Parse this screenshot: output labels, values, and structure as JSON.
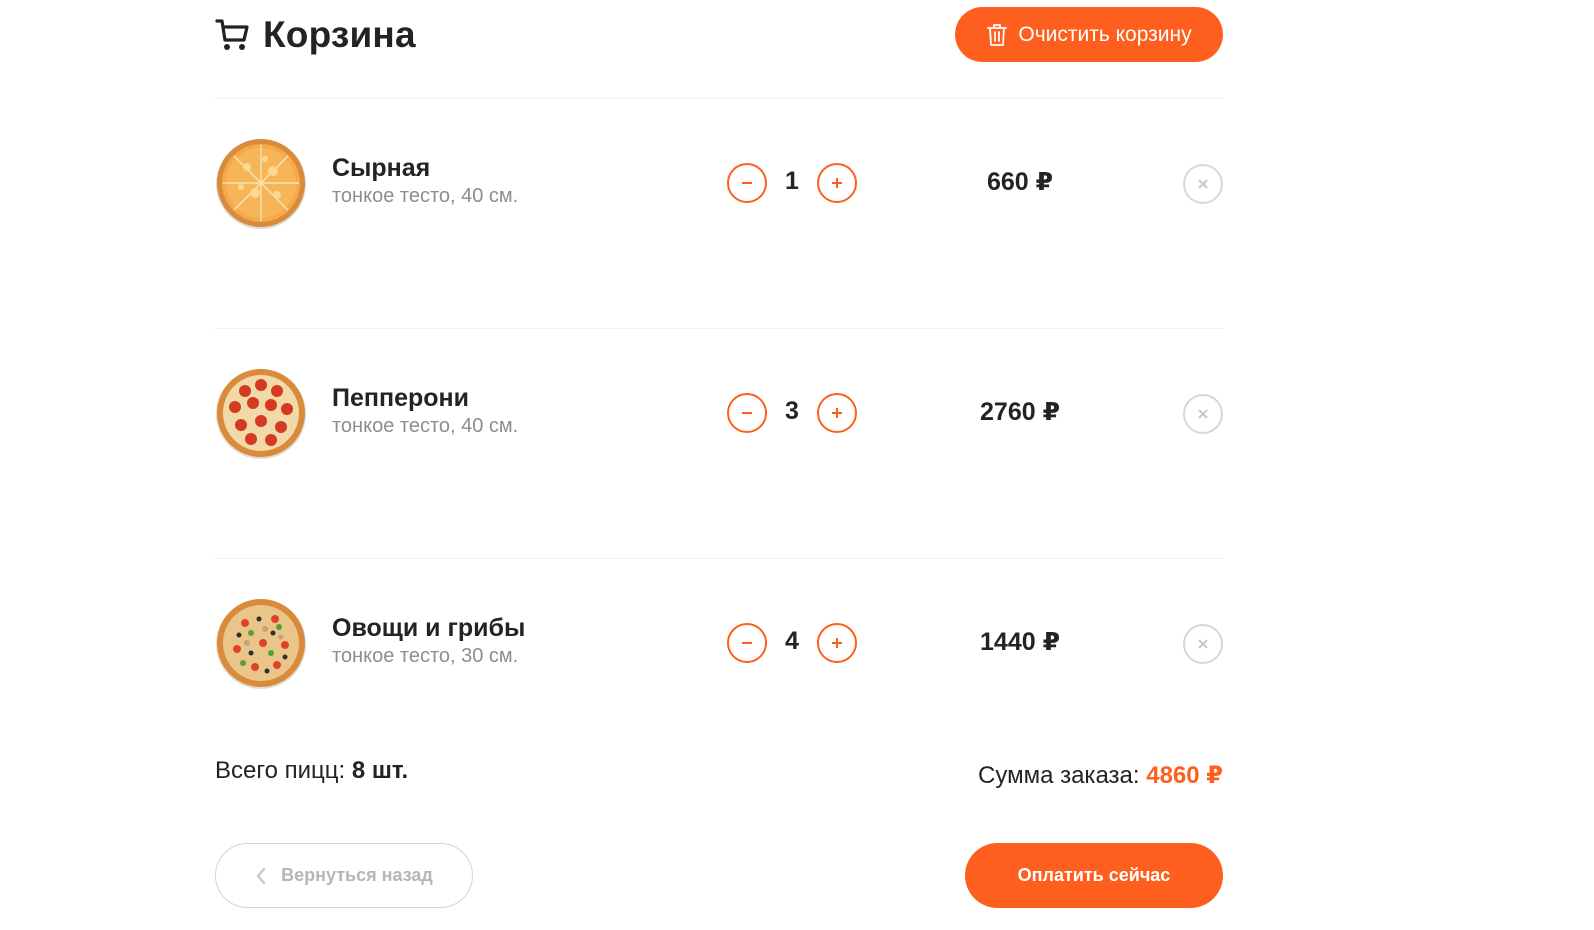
{
  "header": {
    "title": "Корзина",
    "title_icon": "cart-icon",
    "clear_label": "Очистить корзину",
    "clear_icon": "trash-icon"
  },
  "items": [
    {
      "name": "Сырная",
      "desc": "тонкое тесто, 40 см.",
      "count": "1",
      "price": "660 ₽",
      "image": "cheese-pizza"
    },
    {
      "name": "Пепперони",
      "desc": "тонкое тесто, 40 см.",
      "count": "3",
      "price": "2760 ₽",
      "image": "pepperoni-pizza"
    },
    {
      "name": "Овощи и грибы",
      "desc": "тонкое тесто, 30 см.",
      "count": "4",
      "price": "1440 ₽",
      "image": "vegetable-pizza"
    }
  ],
  "footer": {
    "total_count_label": "Всего пицц:",
    "total_count_value": "8 шт.",
    "total_sum_label": "Сумма заказа:",
    "total_sum_value": "4860 ₽",
    "back_label": "Вернуться назад",
    "pay_label": "Оплатить сейчас"
  },
  "colors": {
    "accent": "#fe5f1e",
    "text": "#232323",
    "muted": "#8d8d8d",
    "border": "#d7d7d7"
  }
}
